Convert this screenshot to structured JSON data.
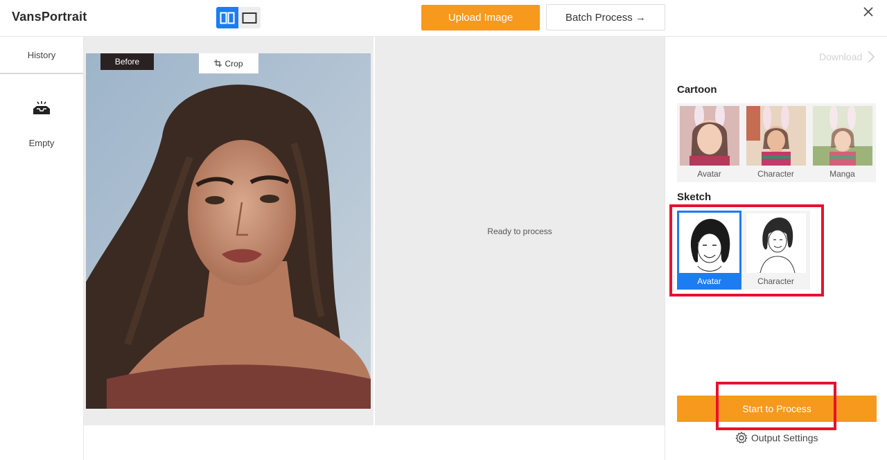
{
  "header": {
    "app_title": "VansPortrait",
    "upload_label": "Upload Image",
    "batch_label": "Batch Process →"
  },
  "history": {
    "tab_label": "History",
    "empty_label": "Empty"
  },
  "canvas": {
    "before_label": "Before",
    "crop_label": "Crop",
    "ready_text": "Ready to process"
  },
  "panel": {
    "download_label": "Download",
    "cartoon_title": "Cartoon",
    "cartoon_styles": [
      {
        "label": "Avatar"
      },
      {
        "label": "Character"
      },
      {
        "label": "Manga"
      }
    ],
    "sketch_title": "Sketch",
    "sketch_styles": [
      {
        "label": "Avatar",
        "selected": true
      },
      {
        "label": "Character",
        "selected": false
      }
    ],
    "start_label": "Start to Process",
    "output_settings_label": "Output Settings"
  },
  "colors": {
    "accent_orange": "#f7991c",
    "accent_blue": "#1d7cf2",
    "highlight_red": "#e8112d"
  }
}
